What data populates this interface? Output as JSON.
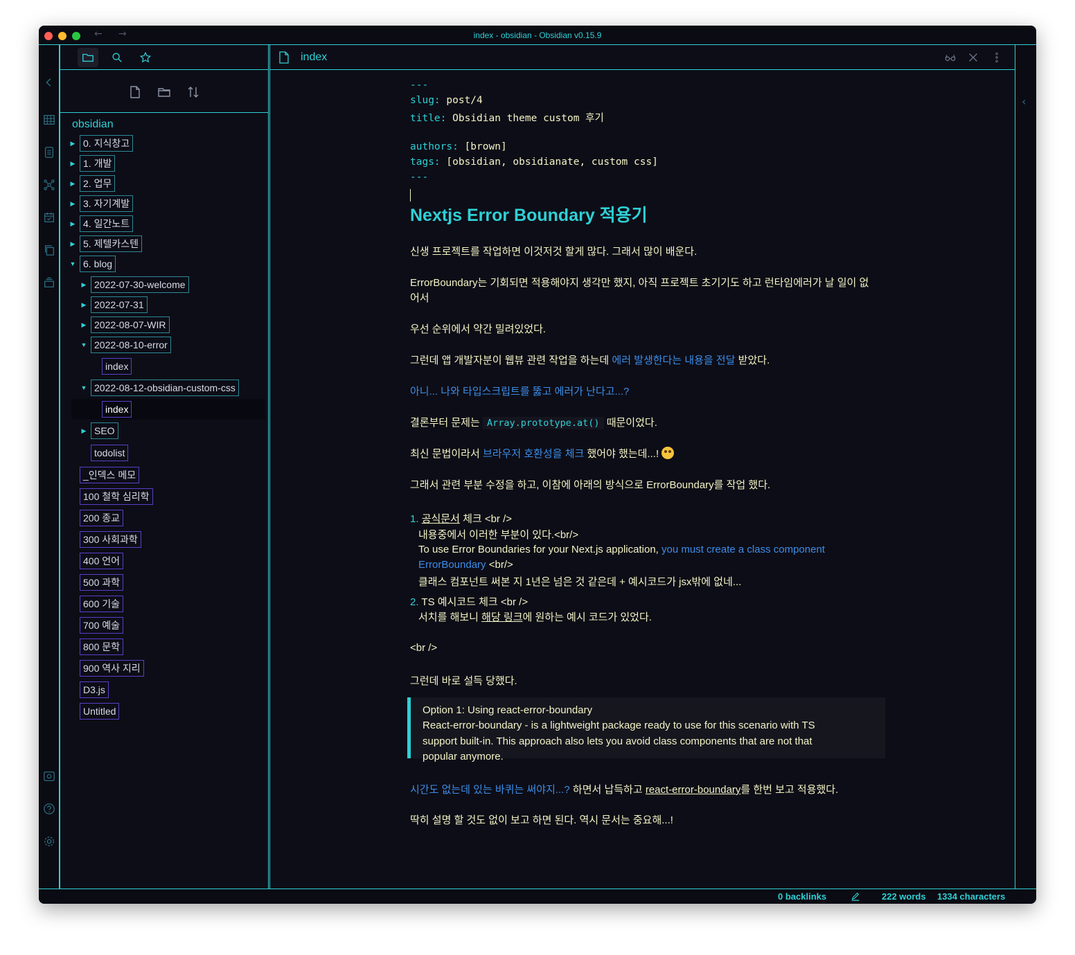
{
  "window": {
    "title": "index - obsidian - Obsidian v0.15.9",
    "nav_back": "←",
    "nav_forward": "→"
  },
  "ribbon": {
    "icons": [
      "collapse-left-icon",
      "table-icon",
      "database-icon",
      "graph-icon",
      "calendar-icon",
      "copy-icon",
      "stack-icon",
      "vault-icon",
      "help-icon",
      "settings-icon"
    ]
  },
  "sidebar": {
    "tabs": [
      "folder-icon",
      "search-icon",
      "star-icon"
    ],
    "actions": [
      "new-note-icon",
      "new-folder-icon",
      "sort-icon"
    ],
    "vault": "obsidian",
    "folders_top": [
      "0. 지식창고",
      "1. 개발",
      "2. 업무",
      "3. 자기계발",
      "4. 일간노트",
      "5. 제텔카스텐",
      "6. blog"
    ],
    "blog_children": [
      "2022-07-30-welcome",
      "2022-07-31",
      "2022-08-07-WIR",
      "2022-08-10-error",
      "index",
      "2022-08-12-obsidian-custom-css",
      "index",
      "SEO",
      "todolist"
    ],
    "files_bottom": [
      "_인덱스 메모",
      "100 철학 심리학",
      "200 종교",
      "300 사회과학",
      "400 언어",
      "500 과학",
      "600 기술",
      "700 예술",
      "800 문학",
      "900 역사 지리",
      "D3.js",
      "Untitled"
    ]
  },
  "editor": {
    "tab_title": "index",
    "frontmatter": {
      "dashes": "---",
      "slug_key": "slug:",
      "slug_val": "post/4",
      "title_key": "title:",
      "title_val": "Obsidian theme custom 후기",
      "authors_key": "authors:",
      "authors_val": "[brown]",
      "tags_key": "tags:",
      "tags_val": "[obsidian, obsidianate, custom css]"
    },
    "heading": "Nextjs Error Boundary 적용기",
    "p1": "신생 프로젝트를 작업하면 이것저것 할게 많다. 그래서 많이 배운다.",
    "p2a": "ErrorBoundary는 기회되면 적용해야지 생각만 했지, 아직 프로젝트 초기기도 하고 런타임에러가 날 일이 없",
    "p2b": "어서",
    "p3": "우선 순위에서 약간 밀려있었다.",
    "p4_text": "그런데 앱 개발자분이 웹뷰 관련 작업을 하는데",
    "p4_link": "에러 발생한다는 내용을 전달",
    "p4_end": "받았다.",
    "p5": "아니... 나와 타입스크립트를 뚫고 에러가 난다고...?",
    "p6_a": "결론부터 문제는",
    "p6_code": "Array.prototype.at()",
    "p6_b": "때문이었다.",
    "p7_a": "최신 문법이라서",
    "p7_link": "브라우저 호환성을 체크",
    "p7_b": "했어야 했는데...!",
    "p8": "그래서 관련 부분 수정을 하고, 이참에 아래의 방식으로 ErrorBoundary를 작업 했다.",
    "li1_num": "1.",
    "li1_ul": "공식문서",
    "li1_rest": "체크 <br />",
    "li1_l2": "내용중에서 이러한 부분이 있다.<br/>",
    "li1_l3a": "To use Error Boundaries for your Next.js application,",
    "li1_l3link": "you must create a class component",
    "li1_l4link": "ErrorBoundary",
    "li1_l4rest": "<br/>",
    "li1_l5": "클래스 컴포넌트 써본 지 1년은 넘은 것 같은데 + 예시코드가 jsx밖에 없네...",
    "li2_num": "2.",
    "li2_text": "TS 예시코드 체크 <br />",
    "li2_l2a": "서치를 해보니",
    "li2_l2ul": "해당 링크",
    "li2_l2b": "에 원하는 예시 코드가 있었다.",
    "br": "<br />",
    "p9": "그런데 바로 설득 당했다.",
    "quote_l1": "Option 1: Using react-error-boundary",
    "quote_l2": "React-error-boundary - is a lightweight package ready to use for this scenario with TS",
    "quote_l3": "support built-in. This approach also lets you avoid class components that are not that",
    "quote_l4": "popular anymore.",
    "p10_link": "시간도 없는데 있는 바퀴는 써야지...?",
    "p10_a": "하면서 납득하고",
    "p10_ul": "react-error-boundary",
    "p10_b": "를 한번 보고 적용했다.",
    "p11": "딱히 설명 할 것도 없이 보고 하면 된다. 역시 문서는 중요해...!"
  },
  "status": {
    "backlinks": "0 backlinks",
    "words": "222 words",
    "characters": "1334 characters"
  }
}
